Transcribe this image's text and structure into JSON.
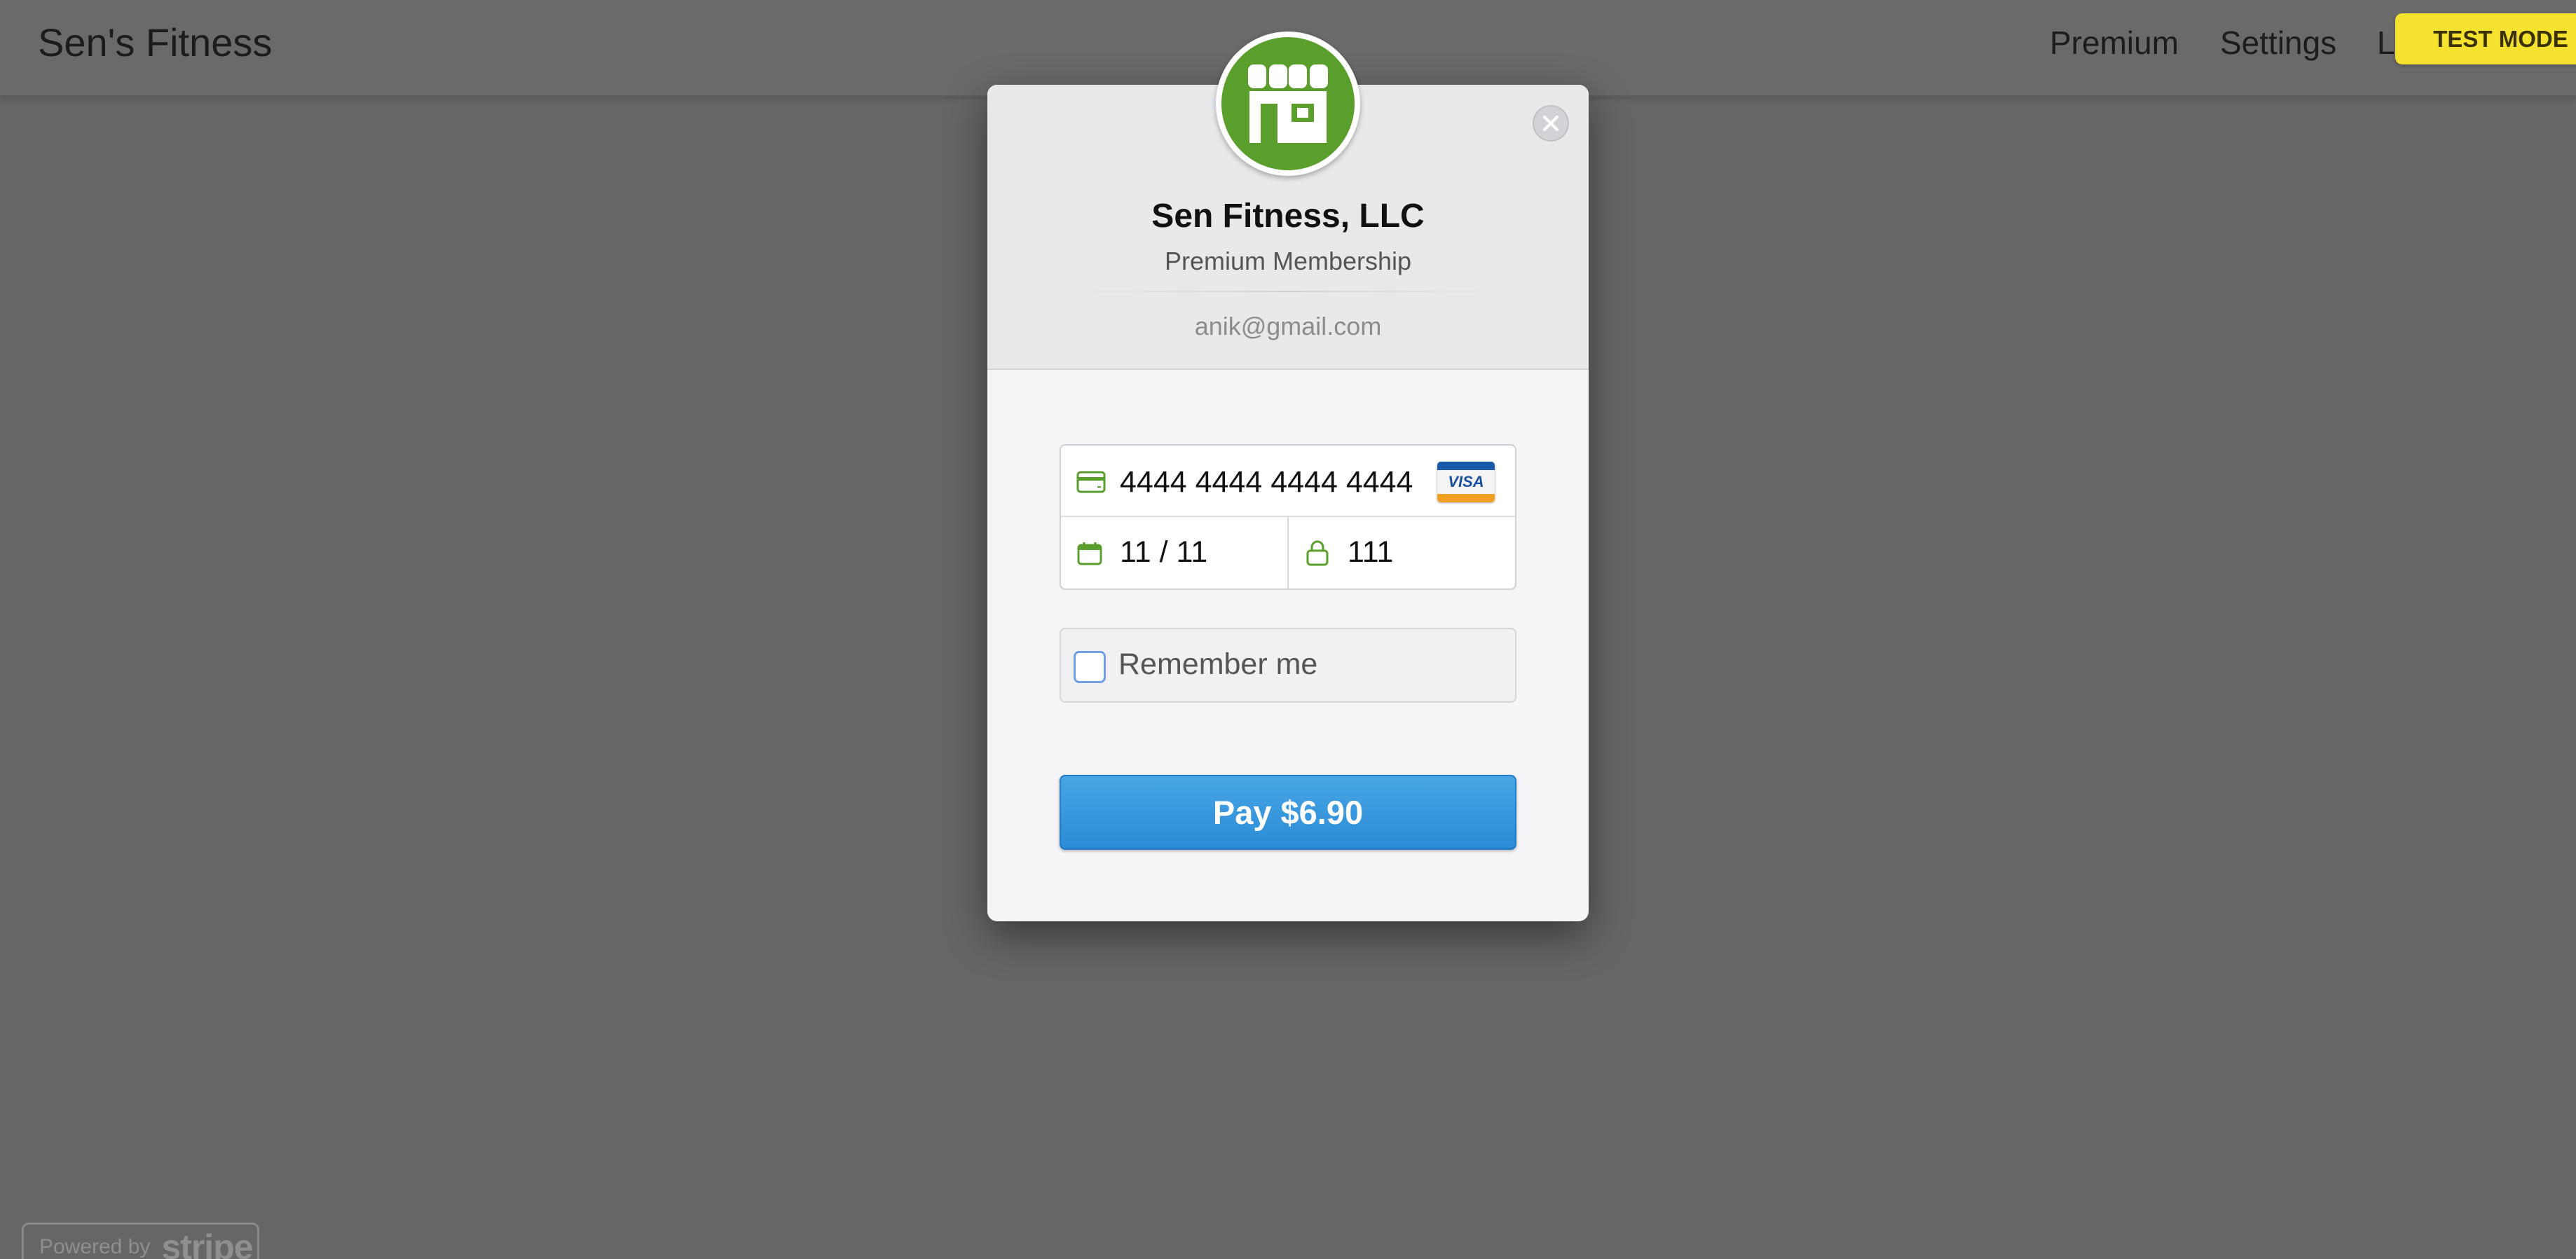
{
  "navbar": {
    "brand": "Sen's Fitness",
    "links": [
      "Premium",
      "Settings",
      "Logout"
    ],
    "test_mode": "TEST MODE"
  },
  "footer": {
    "powered_by": "Powered by",
    "stripe": "stripe"
  },
  "checkout": {
    "merchant": "Sen Fitness, LLC",
    "product": "Premium Membership",
    "email": "anik@gmail.com",
    "card_number": "4444 4444 4444 4444",
    "card_brand": "VISA",
    "expiry": "11 / 11",
    "cvc": "111",
    "remember_label": "Remember me",
    "remember_checked": false,
    "pay_label": "Pay $6.90"
  },
  "colors": {
    "overlay": "#666666",
    "accent_green": "#5a9e2c",
    "pay_blue": "#2b8bd4",
    "test_mode_yellow": "#f5e22e"
  },
  "icons": [
    "close-icon",
    "store-icon",
    "credit-card-icon",
    "calendar-icon",
    "lock-icon",
    "visa-logo"
  ]
}
